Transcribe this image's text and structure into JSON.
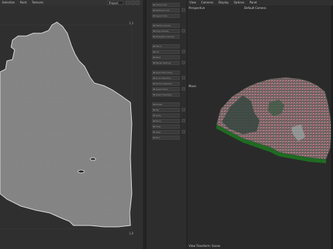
{
  "left_menu": [
    "Selection",
    "Paint",
    "Textures"
  ],
  "project_select": "Project",
  "corner_labels": {
    "top_right": "1,1",
    "bottom_right": "1,0"
  },
  "tool_groups": [
    [
      "Unfold UVs",
      "Optimize UVs",
      "Layout UVs"
    ],
    [
      "Flatten Islands",
      "Align Islands",
      "Straighten Islands"
    ],
    [
      "Stitch",
      "Cut",
      "Weld",
      "Merge Vertices"
    ],
    [
      "Select Boundary",
      "Grow Selection",
      "Shrink Selection",
      "Select Shell",
      "Select Overlaps"
    ],
    [
      "Rotate",
      "Flip",
      "Scale",
      "Move",
      "Snap",
      "Align",
      "Pack"
    ]
  ],
  "right_menu": [
    "View",
    "Cameras",
    "Display",
    "Options",
    "Panel"
  ],
  "viewport": {
    "perspective": "Perspective",
    "camera": "Default Camera",
    "mode": "Move",
    "view_transform": "View Transform: Scene"
  }
}
